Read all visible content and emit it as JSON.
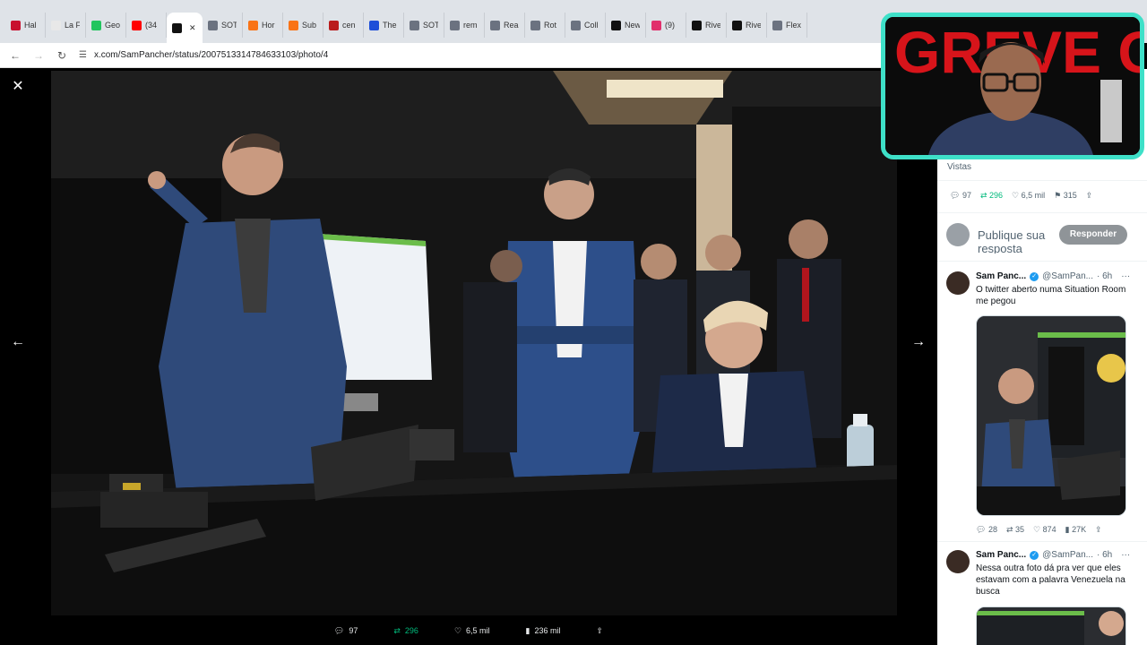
{
  "tabs": [
    {
      "label": "Hal",
      "color": "#c8102e"
    },
    {
      "label": "La F",
      "color": "#e8e8e8"
    },
    {
      "label": "Geo",
      "color": "#22c55e"
    },
    {
      "label": "(34",
      "color": "#ff0000"
    },
    {
      "label": "",
      "color": "#111111",
      "active": true
    },
    {
      "label": "SOT",
      "color": "#6b7280"
    },
    {
      "label": "Hor",
      "color": "#f97316"
    },
    {
      "label": "Sub",
      "color": "#f97316"
    },
    {
      "label": "cen",
      "color": "#b91c1c"
    },
    {
      "label": "The",
      "color": "#1d4ed8"
    },
    {
      "label": "SOT",
      "color": "#6b7280"
    },
    {
      "label": "rem",
      "color": "#6b7280"
    },
    {
      "label": "Rea",
      "color": "#6b7280"
    },
    {
      "label": "Rot",
      "color": "#6b7280"
    },
    {
      "label": "Coll",
      "color": "#6b7280"
    },
    {
      "label": "New",
      "color": "#111111"
    },
    {
      "label": "(9)",
      "color": "#e1306c"
    },
    {
      "label": "Rive",
      "color": "#111111"
    },
    {
      "label": "Rive",
      "color": "#111111"
    },
    {
      "label": "Flex",
      "color": "#6b7280"
    }
  ],
  "address": {
    "url": "x.com/SamPancher/status/2007513314784633103/photo/4"
  },
  "viewer": {
    "actions": {
      "replies": "97",
      "reposts": "296",
      "likes": "6,5 mil",
      "views": "236 mil"
    }
  },
  "sidebar": {
    "views_label": "Vistas",
    "stats": {
      "replies": "97",
      "reposts": "296",
      "likes": "6,5 mil",
      "bookmarks": "315"
    },
    "reply_placeholder": "Publique sua resposta",
    "reply_button": "Responder",
    "tweets": [
      {
        "name": "Sam Panc...",
        "handle": "@SamPan...",
        "time": "· 6h",
        "text": "O twitter aberto numa Situation Room me pegou",
        "actions": {
          "replies": "28",
          "reposts": "35",
          "likes": "874",
          "views": "27K"
        }
      },
      {
        "name": "Sam Panc...",
        "handle": "@SamPan...",
        "time": "· 6h",
        "text": "Nessa outra foto dá pra ver que eles estavam com a palavra Venezuela na busca"
      }
    ]
  },
  "webcam": {
    "banner_text": "GREVE GERAL!"
  },
  "colors": {
    "repost_green": "#00ba7c",
    "verified_blue": "#1d9bf0",
    "cam_border": "#3ee0c8",
    "banner_red": "#d7141a"
  }
}
